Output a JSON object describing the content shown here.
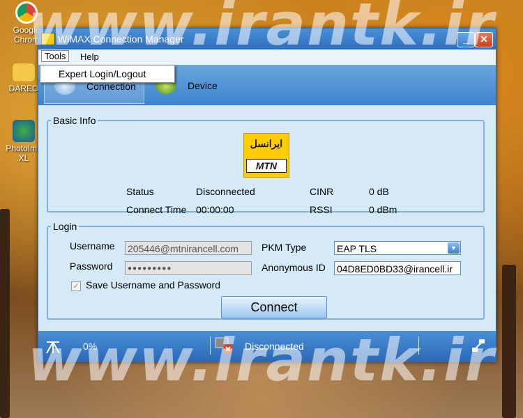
{
  "desktop": {
    "icons": [
      {
        "label": "Google Chrom"
      },
      {
        "label": "DAREO"
      },
      {
        "label": "PhotoImp XL"
      }
    ],
    "watermark": "www.irantk.ir"
  },
  "window": {
    "title": "WiMAX Connection Manager",
    "minimize_glyph": "_",
    "close_glyph": "✕"
  },
  "menubar": {
    "tools": "Tools",
    "help": "Help",
    "dropdown_item": "Expert Login/Logout"
  },
  "nav": {
    "connection": "Connection",
    "device": "Device"
  },
  "basic_info": {
    "legend": "Basic Info",
    "logo_fa": "ايرانسل",
    "logo_mtn": "MTN",
    "status_label": "Status",
    "status_value": "Disconnected",
    "connect_time_label": "Connect Time",
    "connect_time_value": "00:00:00",
    "cinr_label": "CINR",
    "cinr_value": "0 dB",
    "rssi_label": "RSSI",
    "rssi_value": "0 dBm"
  },
  "login": {
    "legend": "Login",
    "username_label": "Username",
    "username_value": "205446@mtnirancell.com",
    "password_label": "Password",
    "password_value": "●●●●●●●●●",
    "pkm_label": "PKM Type",
    "pkm_value": "EAP TLS",
    "anon_label": "Anonymous ID",
    "anon_value": "04D8ED0BD33@irancell.ir",
    "save_label": "Save Username and Password",
    "save_checked": true,
    "connect_button": "Connect"
  },
  "statusbar": {
    "signal": "0%",
    "status": "Disconnected"
  }
}
